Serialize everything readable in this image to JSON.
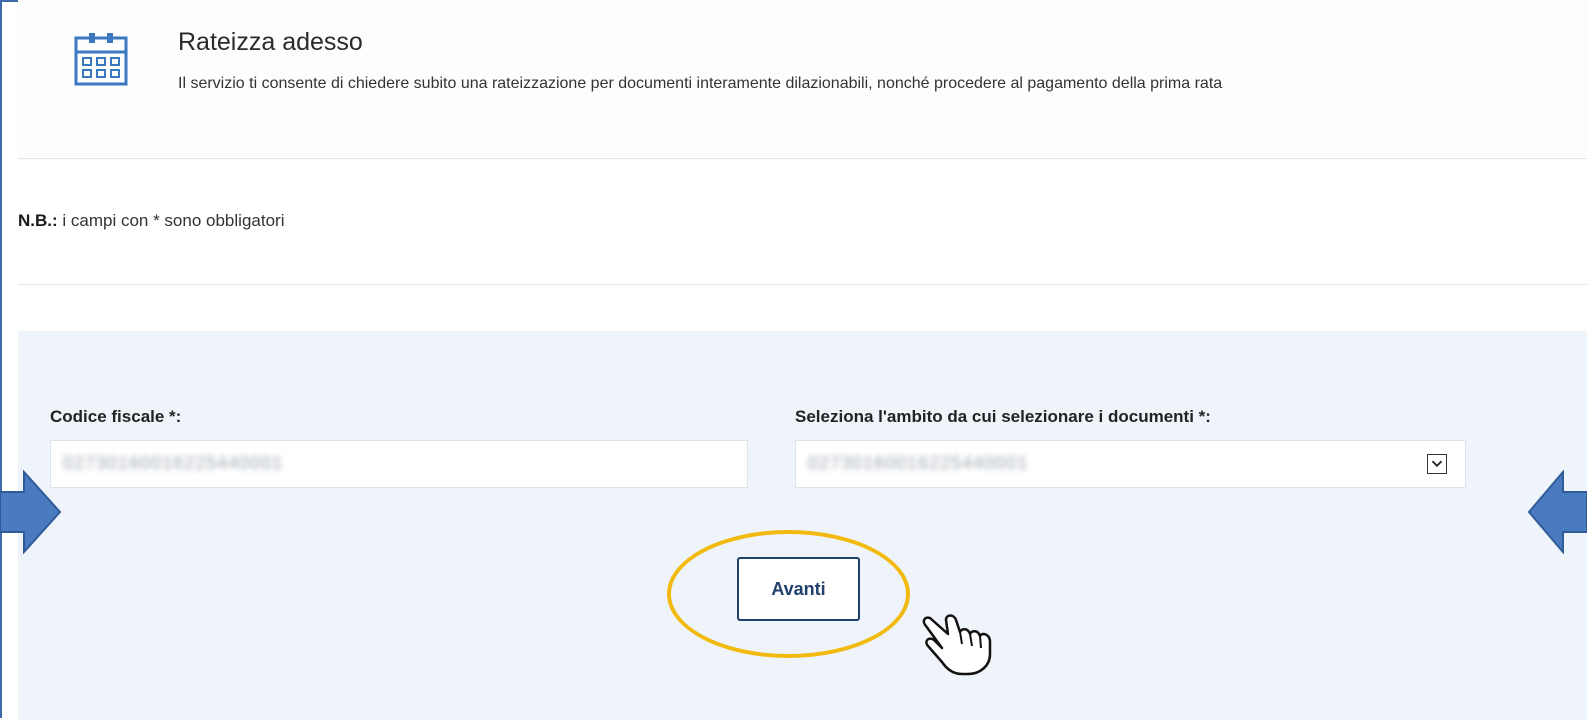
{
  "header": {
    "title": "Rateizza adesso",
    "subtitle": "Il servizio ti consente di chiedere subito una rateizzazione per documenti interamente dilazionabili, nonché procedere al pagamento della prima rata",
    "icon": "calendar-icon"
  },
  "note": {
    "bold": "N.B.:",
    "text": " i campi con * sono obbligatori"
  },
  "form": {
    "codice_fiscale_label": "Codice fiscale *:",
    "codice_fiscale_value": "02730160016225440001",
    "ambito_label": "Seleziona l'ambito da cui selezionare i documenti *:",
    "ambito_value": "02730160016225440001"
  },
  "actions": {
    "next_label": "Avanti"
  },
  "colors": {
    "frame": "#3d6aa8",
    "panel_bg": "#eef4fa",
    "button_border": "#1f3f6d",
    "highlight": "#f2b90f",
    "arrow_fill": "#4a7bc1"
  }
}
